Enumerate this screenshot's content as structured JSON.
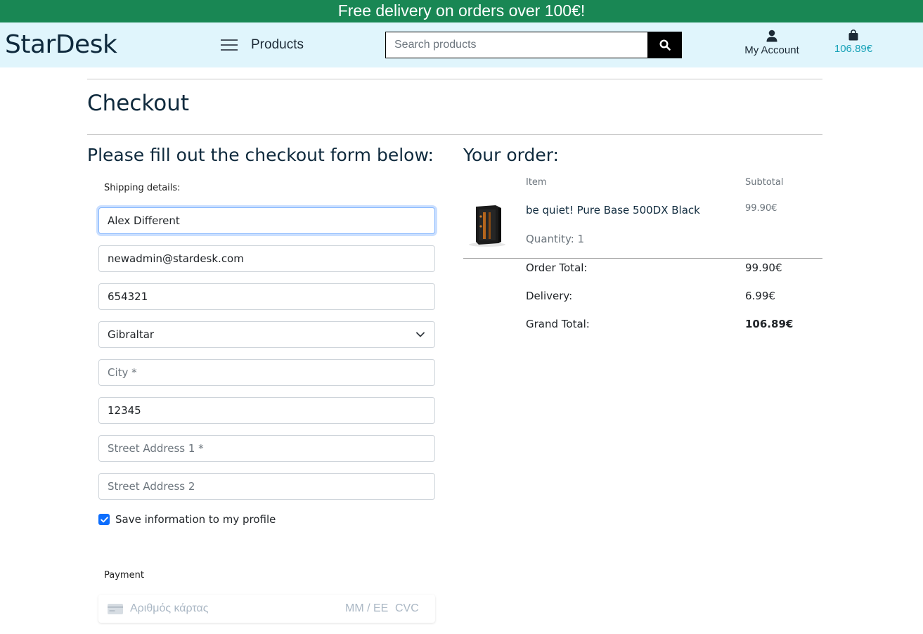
{
  "banner": {
    "text": "Free delivery on orders over 100€!"
  },
  "header": {
    "logo": "StarDesk",
    "nav_products": "Products",
    "search_placeholder": "Search products",
    "account_label": "My Account",
    "cart_total": "106.89€"
  },
  "page": {
    "title": "Checkout",
    "form_heading": "Please fill out the checkout form below:",
    "order_heading": "Your order:"
  },
  "shipping": {
    "label": "Shipping details:",
    "full_name": "Alex Different",
    "email": "newadmin@stardesk.com",
    "phone": "654321",
    "country": "Gibraltar",
    "city_placeholder": "City *",
    "postcode": "12345",
    "street1_placeholder": "Street Address 1 *",
    "street2_placeholder": "Street Address 2",
    "save_info_label": "Save information to my profile",
    "save_info_checked": true
  },
  "payment": {
    "label": "Payment",
    "card_number_placeholder": "Αριθμός κάρτας",
    "expiry_placeholder": "MM / ΕΕ",
    "cvc_placeholder": "CVC"
  },
  "order": {
    "col_item": "Item",
    "col_subtotal": "Subtotal",
    "items": [
      {
        "name": "be quiet! Pure Base 500DX Black",
        "quantity": "Quantity: 1",
        "subtotal": "99.90€"
      }
    ],
    "order_total_label": "Order Total:",
    "order_total": "99.90€",
    "delivery_label": "Delivery:",
    "delivery": "6.99€",
    "grand_total_label": "Grand Total:",
    "grand_total": "106.89€"
  },
  "colors": {
    "banner_bg": "#198754",
    "header_bg": "#e0f5fc",
    "accent_cart": "#17a2b8",
    "checkbox": "#0d6efd"
  },
  "icons": [
    "hamburger-icon",
    "search-icon",
    "user-icon",
    "shopping-bag-icon",
    "chevron-down-icon",
    "check-icon",
    "credit-card-icon"
  ]
}
